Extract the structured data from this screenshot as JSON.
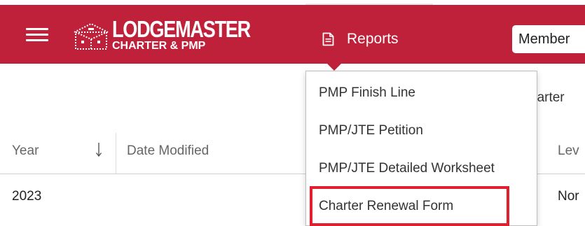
{
  "header": {
    "background_color": "#c0213a",
    "menu_icon": "hamburger-menu-icon",
    "logo": {
      "title": "LODGEMASTER",
      "subtitle": "CHARTER & PMP",
      "icon": "lodge-building-logo"
    },
    "nav": {
      "reports_label": "Reports",
      "reports_icon": "document-icon",
      "members_label": "Member"
    }
  },
  "reports_menu": {
    "items": [
      {
        "label": "PMP Finish Line"
      },
      {
        "label": "PMP/JTE Petition"
      },
      {
        "label": "PMP/JTE Detailed Worksheet"
      },
      {
        "label": "Charter Renewal Form",
        "highlighted": true
      }
    ],
    "highlight_color": "#e0202f"
  },
  "content": {
    "partial_heading": "harter"
  },
  "table": {
    "columns": [
      {
        "label": "Year",
        "sort": "descending",
        "sort_icon": "arrow-down-icon"
      },
      {
        "label": "Date Modified"
      },
      {
        "label": "Lev"
      }
    ],
    "rows": [
      {
        "year": "2023",
        "date_modified": "",
        "level": "Nor"
      }
    ]
  }
}
